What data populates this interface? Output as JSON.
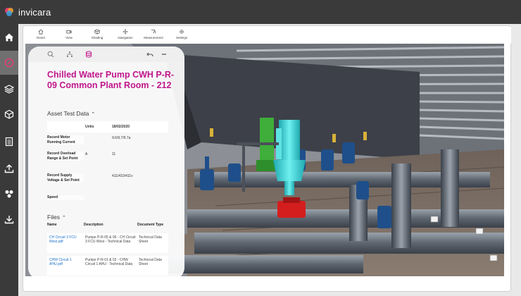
{
  "app": {
    "logo_text": "invicara"
  },
  "toolbar": {
    "items": [
      {
        "label": "Reset",
        "icon": "home-icon"
      },
      {
        "label": "View",
        "icon": "camera-icon"
      },
      {
        "label": "Shading",
        "icon": "cube-icon"
      },
      {
        "label": "Navigation",
        "icon": "move-icon"
      },
      {
        "label": "Measurement",
        "icon": "measure-icon"
      },
      {
        "label": "Settings",
        "icon": "gear-icon"
      }
    ]
  },
  "panel": {
    "title": "Chilled Water Pump CWH P-R-09 Common Plant Room - 212",
    "asset_section": "Asset Test Data",
    "table": {
      "col_units": "Units",
      "col_date": "18/02/2020",
      "rows": [
        {
          "label": "Record Motor Running Current",
          "unit": "",
          "value": "9.6/9.7/9.7a"
        },
        {
          "label": "Record Overload Range & Set Point",
          "unit": "A",
          "value": "11"
        },
        {
          "label": "Record Supply Voltage & Set Point",
          "unit": "",
          "value": "411/410/411v"
        },
        {
          "label": "Speed",
          "unit": "",
          "value": ""
        }
      ]
    },
    "files_section": "Files",
    "files_table": {
      "col_name": "Name",
      "col_description": "Description",
      "col_doctype": "Document Type",
      "rows": [
        {
          "name": "CH Circuit 3 FCU West.pdf",
          "description": "Pumps P-R-05 & 06 - CH Circuit 3 FCU West - Technical Data",
          "doctype": "Technical Data Sheet"
        },
        {
          "name": "CHW Circuit 1 AHU.pdf",
          "description": "Pumps P-R-01 & 02 - CHW Circuit 1 AHU - Technical Data",
          "doctype": "Technical Data Sheet"
        }
      ]
    }
  },
  "colors": {
    "accent": "#c0168b",
    "link": "#1a6fc9",
    "nav_bg": "#3a3a3a",
    "pump_cyan": "#3fd6d6",
    "pump_red": "#d41e1e",
    "pipe_grey": "#6b7480",
    "valve_blue": "#1f4f8a"
  }
}
